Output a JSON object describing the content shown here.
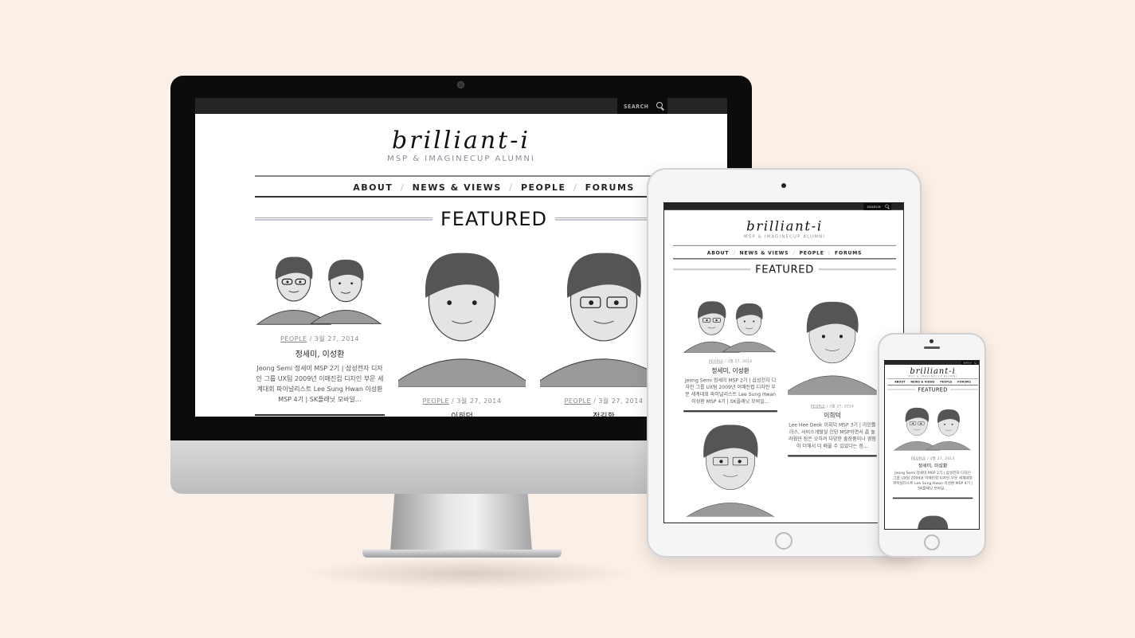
{
  "site": {
    "title": "brilliant-i",
    "subtitle": "MSP & IMAGINECUP ALUMNI",
    "search_label": "SEARCH",
    "nav": [
      "ABOUT",
      "NEWS & VIEWS",
      "PEOPLE",
      "FORUMS"
    ],
    "section_title": "FEATURED",
    "posts": [
      {
        "category": "PEOPLE",
        "date": "3월 27, 2014",
        "name": "정세미, 이성환",
        "excerpt": "Jeong Semi 정세미 MSP 2기 | 삼성전자 디자인 그룹 UX팀 2009년 이매진컵 디자인 부문 세계대회 파이널리스트 Lee Sung Hwan 이성환 MSP 4기 | SK플래닛 모바일…"
      },
      {
        "category": "PEOPLE",
        "date": "3월 27, 2014",
        "name": "이희덕",
        "excerpt": "Lee Hee Deok 이희덕 MSP 3기 | 라인플러스, 서비스개발실 인턴 MSP하면서 좀 놀라웠던 점은 오히려 다양한 출장품이나 경험이 더해서 더 배울 수 있었다는 점…"
      },
      {
        "category": "PEOPLE",
        "date": "3월 27, 2014",
        "name": "정길환"
      }
    ]
  },
  "colors": {
    "background": "#fbf0e7",
    "topbar": "#252527",
    "subtitle": "#8a8d9a"
  }
}
